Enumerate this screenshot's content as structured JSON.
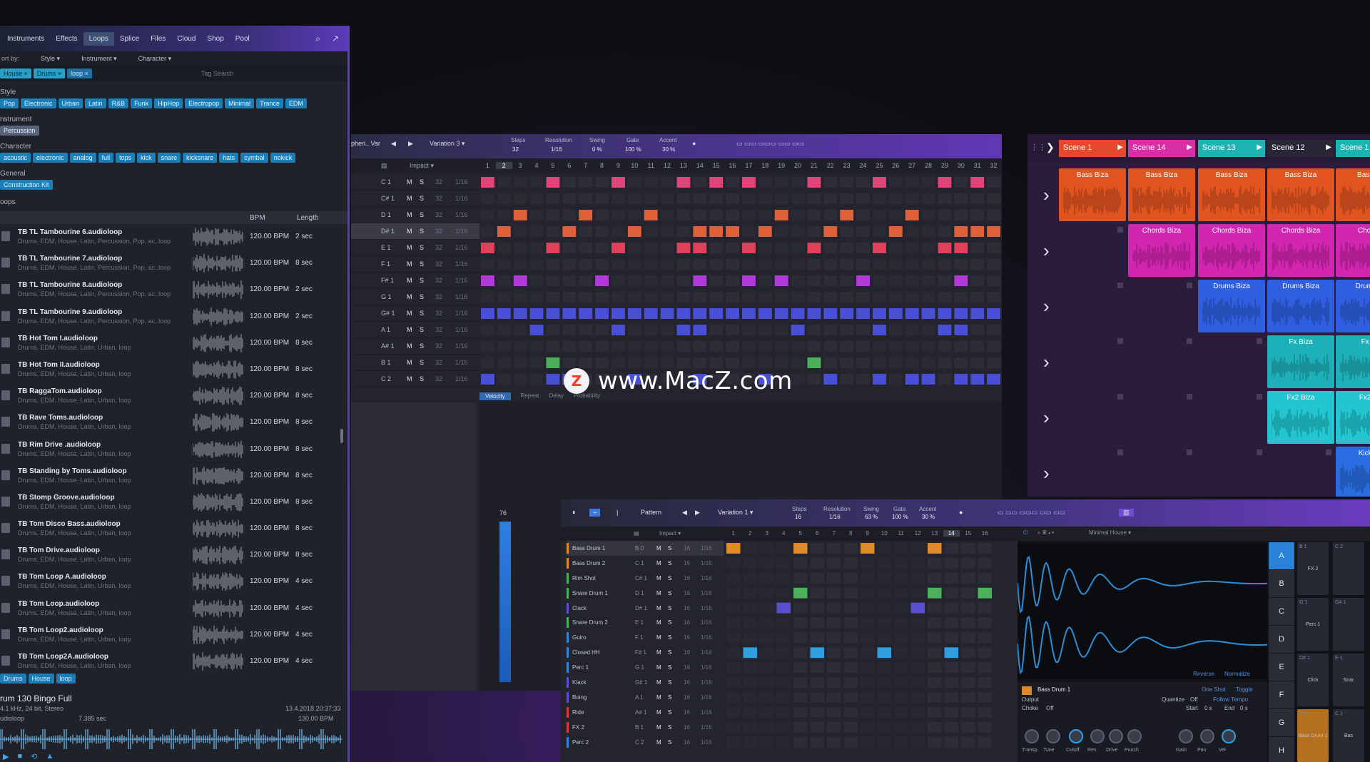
{
  "browser": {
    "tabs": [
      "Instruments",
      "Effects",
      "Loops",
      "Splice",
      "Files",
      "Cloud",
      "Shop",
      "Pool"
    ],
    "active_tab": "Loops",
    "sort_label": "ort by:",
    "sort_style": "Style",
    "sort_instrument": "Instrument",
    "sort_character": "Character",
    "filter_chips": [
      "House ×",
      "Drums ×",
      "loop ×"
    ],
    "tag_search_placeholder": "Tag Search",
    "style_label": "Style",
    "style_tags": [
      "Pop",
      "Electronic",
      "Urban",
      "Latin",
      "R&B",
      "Funk",
      "HipHop",
      "Electropop",
      "Minimal",
      "Trance",
      "EDM"
    ],
    "instrument_label": "nstrument",
    "instrument_tags": [
      "Percussion"
    ],
    "character_label": "Character",
    "character_tags": [
      "acoustic",
      "electronic",
      "analog",
      "full",
      "tops",
      "kick",
      "snare",
      "kicksnare",
      "hats",
      "cymbal",
      "nokick"
    ],
    "general_label": "General",
    "general_tags": [
      "Construction Kit"
    ],
    "loops_label": "oops",
    "col_bpm": "BPM",
    "col_length": "Length",
    "loops": [
      {
        "name": "TB TL Tambourine 6.audioloop",
        "tags": "Drums, EDM, House, Latin, Percussion, Pop, ac..loop",
        "bpm": "120.00 BPM",
        "len": "2 sec"
      },
      {
        "name": "TB TL Tambourine 7.audioloop",
        "tags": "Drums, EDM, House, Latin, Percussion, Pop, ac..loop",
        "bpm": "120.00 BPM",
        "len": "8 sec"
      },
      {
        "name": "TB TL Tambourine 8.audioloop",
        "tags": "Drums, EDM, House, Latin, Percussion, Pop, ac..loop",
        "bpm": "120.00 BPM",
        "len": "2 sec"
      },
      {
        "name": "TB TL Tambourine 9.audioloop",
        "tags": "Drums, EDM, House, Latin, Percussion, Pop, ac..loop",
        "bpm": "120.00 BPM",
        "len": "2 sec"
      },
      {
        "name": "TB Hot Tom I.audioloop",
        "tags": "Drums, EDM, House, Latin, Urban, loop",
        "bpm": "120.00 BPM",
        "len": "8 sec"
      },
      {
        "name": "TB Hot Tom II.audioloop",
        "tags": "Drums, EDM, House, Latin, Urban, loop",
        "bpm": "120.00 BPM",
        "len": "8 sec"
      },
      {
        "name": "TB RaggaTom.audioloop",
        "tags": "Drums, EDM, House, Latin, Urban, loop",
        "bpm": "120.00 BPM",
        "len": "8 sec"
      },
      {
        "name": "TB Rave Toms.audioloop",
        "tags": "Drums, EDM, House, Latin, Urban, loop",
        "bpm": "120.00 BPM",
        "len": "8 sec"
      },
      {
        "name": "TB Rim Drive .audioloop",
        "tags": "Drums, EDM, House, Latin, Urban, loop",
        "bpm": "120.00 BPM",
        "len": "8 sec"
      },
      {
        "name": "TB Standing by Toms.audioloop",
        "tags": "Drums, EDM, House, Latin, Urban, loop",
        "bpm": "120.00 BPM",
        "len": "8 sec"
      },
      {
        "name": "TB Stomp Groove.audioloop",
        "tags": "Drums, EDM, House, Latin, Urban, loop",
        "bpm": "120.00 BPM",
        "len": "8 sec"
      },
      {
        "name": "TB Tom Disco Bass.audioloop",
        "tags": "Drums, EDM, House, Latin, Urban, loop",
        "bpm": "120.00 BPM",
        "len": "8 sec"
      },
      {
        "name": "TB Tom Drive.audioloop",
        "tags": "Drums, EDM, House, Latin, Urban, loop",
        "bpm": "120.00 BPM",
        "len": "8 sec"
      },
      {
        "name": "TB Tom Loop A.audioloop",
        "tags": "Drums, EDM, House, Latin, Urban, loop",
        "bpm": "120.00 BPM",
        "len": "4 sec"
      },
      {
        "name": "TB Tom Loop.audioloop",
        "tags": "Drums, EDM, House, Latin, Urban, loop",
        "bpm": "120.00 BPM",
        "len": "4 sec"
      },
      {
        "name": "TB Tom Loop2.audioloop",
        "tags": "Drums, EDM, House, Latin, Urban, loop",
        "bpm": "120.00 BPM",
        "len": "4 sec"
      },
      {
        "name": "TB Tom Loop2A.audioloop",
        "tags": "Drums, EDM, House, Latin, Urban, loop",
        "bpm": "120.00 BPM",
        "len": "4 sec"
      }
    ],
    "footer_tags": [
      "Drums",
      "House",
      "loop"
    ],
    "info_title": "rum 130 Bingo Full",
    "info_format": "4.1 kHz, 24 bit, Stereo",
    "info_type": "udioloop",
    "info_duration": "7.385 sec",
    "info_date": "13.4.2018 20:37:33",
    "info_bpm": "130.00 BPM"
  },
  "pattern": {
    "name": "pheri.. Var",
    "variation": "Variation 3",
    "steps_label": "Steps",
    "steps_value": "32",
    "resolution_label": "Resolution",
    "resolution_value": "1/16",
    "swing_label": "Swing",
    "swing_value": "0 %",
    "gate_label": "Gate",
    "gate_value": "100 %",
    "accent_label": "Accent",
    "accent_value": "30 %",
    "instrument": "Impact",
    "step_numbers": [
      "1",
      "2",
      "3",
      "4",
      "5",
      "6",
      "7",
      "8",
      "9",
      "10",
      "11",
      "12",
      "13",
      "14",
      "15",
      "16",
      "17",
      "18",
      "19",
      "20",
      "21",
      "22",
      "23",
      "24",
      "25",
      "26",
      "27",
      "28",
      "29",
      "30",
      "31",
      "32"
    ],
    "lanes": [
      {
        "note": "C 1",
        "m": "M",
        "s": "S",
        "v": "32",
        "r": "1/16"
      },
      {
        "note": "C# 1",
        "m": "M",
        "s": "S",
        "v": "32",
        "r": "1/16"
      },
      {
        "note": "D 1",
        "m": "M",
        "s": "S",
        "v": "32",
        "r": "1/16"
      },
      {
        "note": "D# 1",
        "m": "M",
        "s": "S",
        "v": "32",
        "r": "1/16"
      },
      {
        "note": "E 1",
        "m": "M",
        "s": "S",
        "v": "32",
        "r": "1/16"
      },
      {
        "note": "F 1",
        "m": "M",
        "s": "S",
        "v": "32",
        "r": "1/16"
      },
      {
        "note": "F# 1",
        "m": "M",
        "s": "S",
        "v": "32",
        "r": "1/16"
      },
      {
        "note": "G 1",
        "m": "M",
        "s": "S",
        "v": "32",
        "r": "1/16"
      },
      {
        "note": "G# 1",
        "m": "M",
        "s": "S",
        "v": "32",
        "r": "1/16"
      },
      {
        "note": "A 1",
        "m": "M",
        "s": "S",
        "v": "32",
        "r": "1/16"
      },
      {
        "note": "A# 1",
        "m": "M",
        "s": "S",
        "v": "32",
        "r": "1/16"
      },
      {
        "note": "B 1",
        "m": "M",
        "s": "S",
        "v": "32",
        "r": "1/16"
      },
      {
        "note": "C 2",
        "m": "M",
        "s": "S",
        "v": "32",
        "r": "1/16"
      }
    ],
    "tabs": [
      "Velocity",
      "Repeat",
      "Delay",
      "Probability"
    ],
    "velocity_value": "76"
  },
  "scenes": {
    "headers": [
      {
        "label": "Scene 1",
        "color": "#e3492a"
      },
      {
        "label": "Scene 14",
        "color": "#d92fa6"
      },
      {
        "label": "Scene 13",
        "color": "#1fb3b3"
      },
      {
        "label": "Scene 12",
        "color": "#2a2636"
      },
      {
        "label": "Scene 1",
        "color": "#1fb3b3"
      }
    ],
    "clips": [
      {
        "label": "Bass Biza"
      },
      {
        "label": "Bass Biza"
      },
      {
        "label": "Bass Biza"
      },
      {
        "label": "Bass Biza"
      },
      {
        "label": "Bass Bi"
      },
      {
        "label": "Chords Biza"
      },
      {
        "label": "Chords Biza"
      },
      {
        "label": "Chords Biza"
      },
      {
        "label": "Chords"
      },
      {
        "label": "Drums Biza"
      },
      {
        "label": "Drums Biza"
      },
      {
        "label": "Drums B"
      },
      {
        "label": "Fx Biza"
      },
      {
        "label": "Fx Bi"
      },
      {
        "label": "Fx2 Biza"
      },
      {
        "label": "Fx2 Bi"
      },
      {
        "label": "Kick Bi"
      }
    ]
  },
  "drum": {
    "pattern_label": "Pattern",
    "variation": "Variation 1",
    "steps_label": "Steps",
    "steps_value": "16",
    "resolution_label": "Resolution",
    "resolution_value": "1/16",
    "swing_label": "Swing",
    "swing_value": "63 %",
    "gate_label": "Gate",
    "gate_value": "100 %",
    "accent_label": "Accent",
    "accent_value": "30 %",
    "instrument": "Impact",
    "kit": "Minimal House",
    "step_numbers": [
      "1",
      "2",
      "3",
      "4",
      "5",
      "6",
      "7",
      "8",
      "9",
      "10",
      "11",
      "12",
      "13",
      "14",
      "15",
      "16"
    ],
    "lanes": [
      {
        "name": "Bass Drum 1",
        "key": "B 0",
        "color": "#e08a2a"
      },
      {
        "name": "Bass Drum 2",
        "key": "C 1",
        "color": "#e08a2a"
      },
      {
        "name": "Rim Shot",
        "key": "C# 1",
        "color": "#4db05a"
      },
      {
        "name": "Snare Drum 1",
        "key": "D 1",
        "color": "#4db05a"
      },
      {
        "name": "Clack",
        "key": "D# 1",
        "color": "#5a4fcf"
      },
      {
        "name": "Snare Drum 2",
        "key": "E 1",
        "color": "#4db05a"
      },
      {
        "name": "Guiro",
        "key": "F 1",
        "color": "#2f85d8"
      },
      {
        "name": "Closed HH",
        "key": "F# 1",
        "color": "#2f85d8"
      },
      {
        "name": "Perc 1",
        "key": "G 1",
        "color": "#2f85d8"
      },
      {
        "name": "Klack",
        "key": "G# 1",
        "color": "#5a4fcf"
      },
      {
        "name": "Boing",
        "key": "A 1",
        "color": "#5a4fcf"
      },
      {
        "name": "Ride",
        "key": "A# 1",
        "color": "#d33a3a"
      },
      {
        "name": "FX 2",
        "key": "B 1",
        "color": "#d33a3a"
      },
      {
        "name": "Perc 2",
        "key": "C 2",
        "color": "#2f85d8"
      }
    ],
    "m": "M",
    "s": "S",
    "v": "16",
    "r": "1/16",
    "sample_name": "Bass Drum 1",
    "sample_output": "Output",
    "sample_mode": "One Shot",
    "sample_toggle": "Toggle",
    "quantize_label": "Quantize",
    "quantize_value": "Off",
    "follow_tempo": "Follow Tempo",
    "choke_label": "Choke",
    "choke_value": "Off",
    "start_label": "Start",
    "start_value": "0 s",
    "end_label": "End",
    "end_value": "0 s",
    "reverse": "Reverse",
    "normalize": "Normalize",
    "knobs": [
      "Transp.",
      "Tune",
      "Cutoff",
      "Res",
      "Drive",
      "Punch",
      "Gain",
      "Pan",
      "Vel"
    ],
    "pad_letters": [
      "A",
      "B",
      "C",
      "D",
      "E",
      "F",
      "G",
      "H"
    ],
    "pads": [
      {
        "key": "B 1",
        "name": "FX 2"
      },
      {
        "key": "C 2",
        "name": ""
      },
      {
        "key": "G 1",
        "name": "Perc 1"
      },
      {
        "key": "G# 1",
        "name": ""
      },
      {
        "key": "D# 1",
        "name": "Click"
      },
      {
        "key": "E 1",
        "name": "Snar"
      },
      {
        "key": "B 0",
        "name": "Bass Drum 1"
      },
      {
        "key": "C 1",
        "name": "Bas"
      }
    ]
  },
  "watermark": {
    "logo": "Z",
    "text": "www.MacZ.com"
  }
}
